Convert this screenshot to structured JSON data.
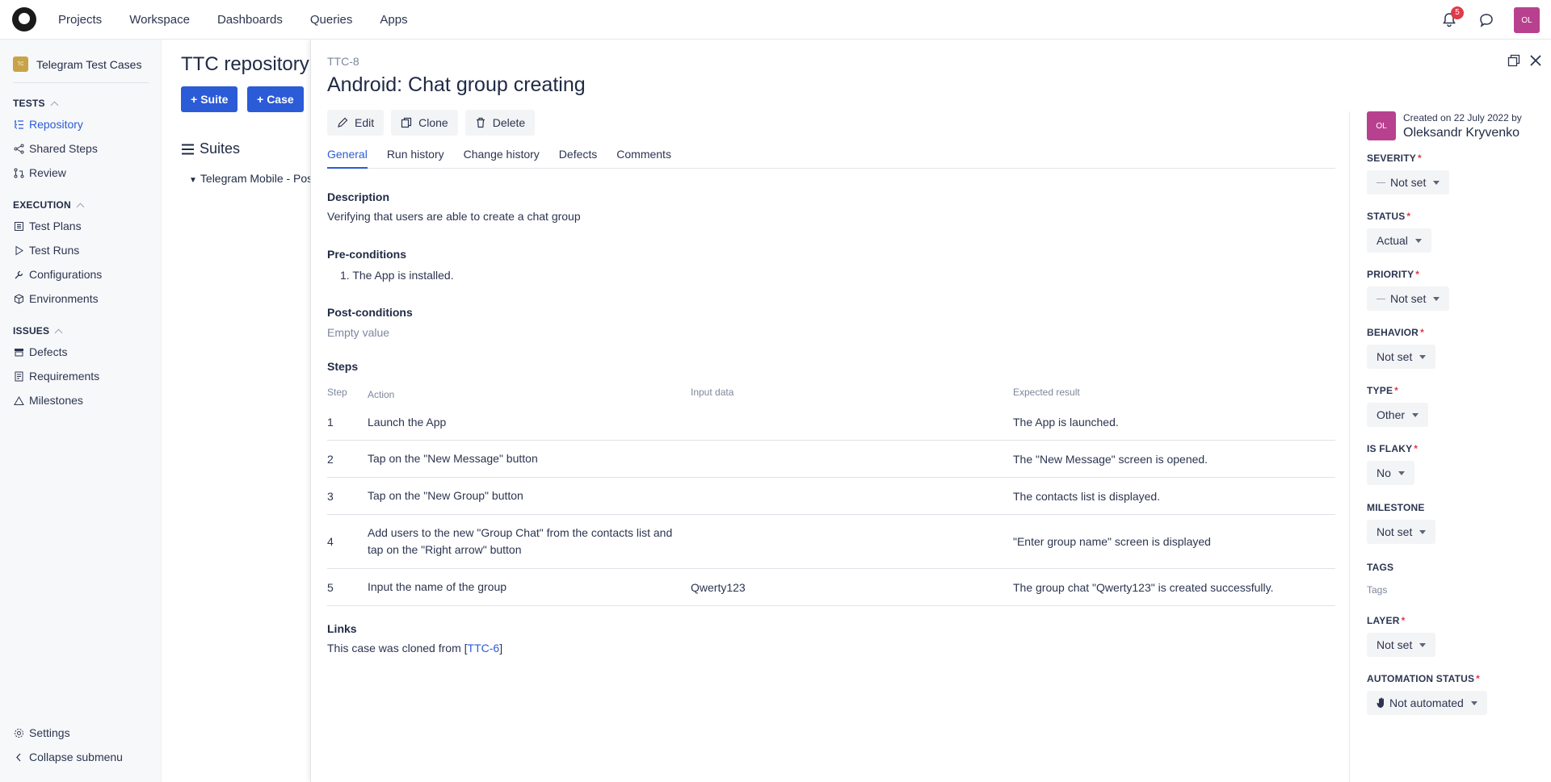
{
  "topnav": {
    "items": [
      "Projects",
      "Workspace",
      "Dashboards",
      "Queries",
      "Apps"
    ],
    "notifications_count": "5",
    "user_initials": "OL"
  },
  "sidebar": {
    "project_name": "Telegram Test Cases",
    "project_icon_text": "TC",
    "tests_heading": "TESTS",
    "tests_items": [
      "Repository",
      "Shared Steps",
      "Review"
    ],
    "execution_heading": "EXECUTION",
    "execution_items": [
      "Test Plans",
      "Test Runs",
      "Configurations",
      "Environments"
    ],
    "issues_heading": "ISSUES",
    "issues_items": [
      "Defects",
      "Requirements",
      "Milestones"
    ],
    "settings": "Settings",
    "collapse": "Collapse submenu"
  },
  "repo": {
    "title": "TTC repository",
    "suite_button": "Suite",
    "case_button": "Case",
    "suites_heading": "Suites",
    "suite_node": "Telegram Mobile - Pos"
  },
  "case": {
    "id": "TTC-8",
    "title": "Android: Chat group creating",
    "actions": {
      "edit": "Edit",
      "clone": "Clone",
      "delete": "Delete"
    },
    "tabs": [
      "General",
      "Run history",
      "Change history",
      "Defects",
      "Comments"
    ],
    "description_label": "Description",
    "description": "Verifying that users are able to create a chat group",
    "preconditions_label": "Pre-conditions",
    "preconditions": [
      "1. The App is installed."
    ],
    "postconditions_label": "Post-conditions",
    "postconditions": "Empty value",
    "steps_label": "Steps",
    "steps_columns": [
      "Step",
      "Action",
      "Input data",
      "Expected result"
    ],
    "steps": [
      {
        "n": "1",
        "action": "Launch the App",
        "input": "",
        "expected": "The App is launched."
      },
      {
        "n": "2",
        "action": "Tap on the \"New Message\" button",
        "input": "",
        "expected": "The \"New Message\" screen is opened."
      },
      {
        "n": "3",
        "action": "Tap on the \"New Group\" button",
        "input": "",
        "expected": "The contacts list is displayed."
      },
      {
        "n": "4",
        "action": "Add users to the new \"Group Chat\" from the contacts list and tap on the \"Right arrow\" button",
        "input": "",
        "expected": "\"Enter group name\" screen is displayed"
      },
      {
        "n": "5",
        "action": "Input the name of the group",
        "input": "Qwerty123",
        "expected": "The group chat \"Qwerty123\" is created successfully."
      }
    ],
    "links_label": "Links",
    "links_prefix": "This case was cloned from [",
    "links_ref": "TTC-6",
    "links_suffix": "]"
  },
  "panel": {
    "author_initials": "OL",
    "created": "Created on 22 July 2022 by",
    "author": "Oleksandr Kryvenko",
    "fields": [
      {
        "label": "SEVERITY",
        "required": true,
        "value": "Not set",
        "dash": true
      },
      {
        "label": "STATUS",
        "required": true,
        "value": "Actual",
        "dash": false
      },
      {
        "label": "PRIORITY",
        "required": true,
        "value": "Not set",
        "dash": true
      },
      {
        "label": "BEHAVIOR",
        "required": true,
        "value": "Not set",
        "dash": false
      },
      {
        "label": "TYPE",
        "required": true,
        "value": "Other",
        "dash": false
      },
      {
        "label": "IS FLAKY",
        "required": true,
        "value": "No",
        "dash": false
      },
      {
        "label": "MILESTONE",
        "required": false,
        "value": "Not set",
        "dash": false
      },
      {
        "label": "TAGS",
        "required": false,
        "value": "Tags",
        "dash": false
      },
      {
        "label": "LAYER",
        "required": true,
        "value": "Not set",
        "dash": false
      },
      {
        "label": "AUTOMATION STATUS",
        "required": true,
        "value": "Not automated",
        "dash": false
      }
    ]
  },
  "colors": {
    "accent": "#2b5bd7",
    "avatar": "#b8418f",
    "required": "#e0394a"
  }
}
